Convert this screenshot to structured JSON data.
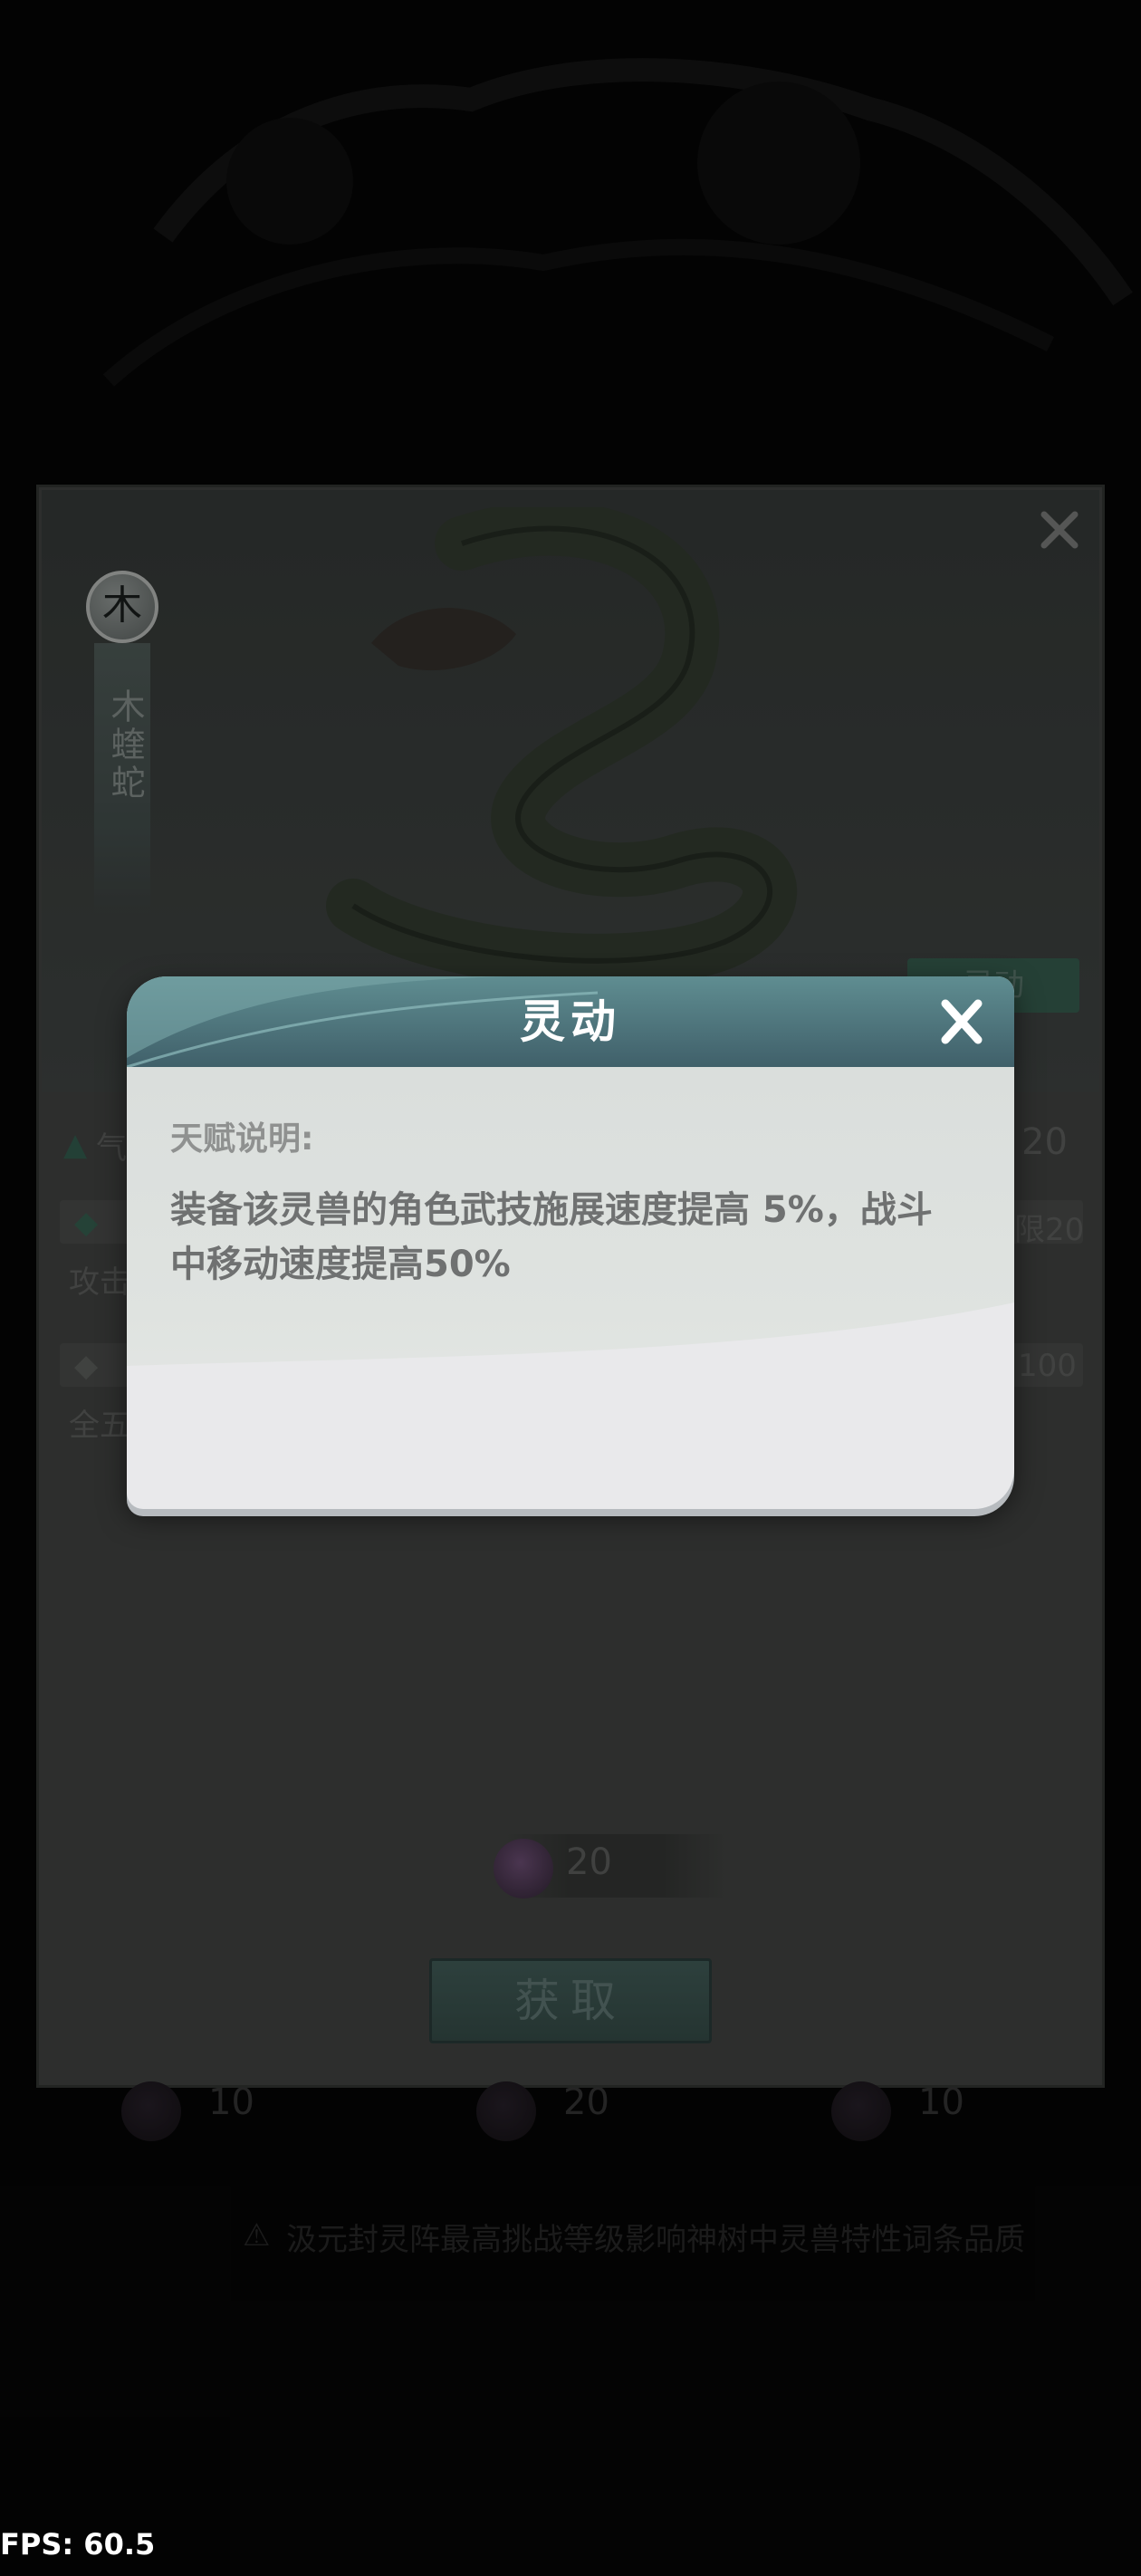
{
  "card": {
    "element": "木",
    "beast_name": "木蝰蛇",
    "trait_tag": "灵动",
    "cost_value": "20",
    "obtain_label": "获取",
    "partial_texts": [
      "气",
      "【",
      "攻击",
      "【",
      "全五",
      "限20",
      "100",
      "20"
    ]
  },
  "bottom_costs": [
    "10",
    "20",
    "10"
  ],
  "notice": "汲元封灵阵最高挑战等级影响神树中灵兽特性词条品质",
  "popup": {
    "title": "灵动",
    "section_label": "天赋说明:",
    "description": "装备该灵兽的角色武技施展速度提高 5%，战斗中移动速度提高50%"
  },
  "fps": "FPS: 60.5",
  "colors": {
    "header_top": "#5f8d91",
    "header_bottom": "#40606a",
    "body": "#dadedc",
    "accent_green": "#3f6b5b"
  }
}
